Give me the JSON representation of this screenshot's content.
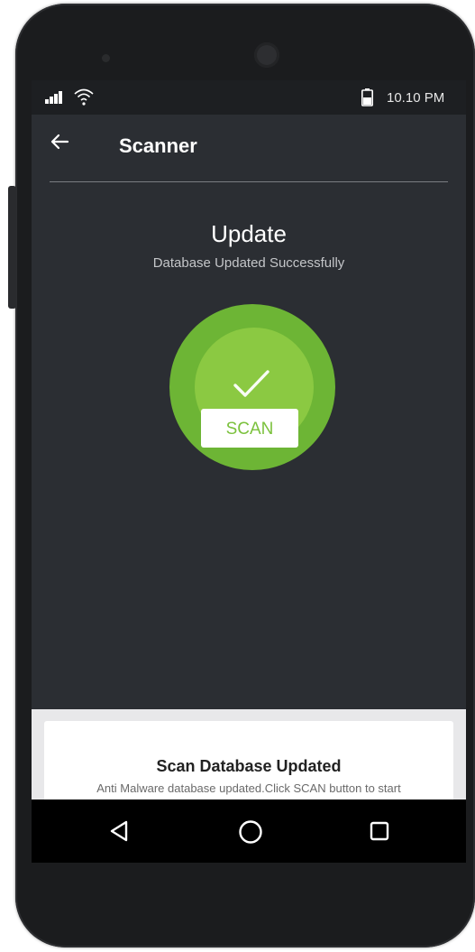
{
  "status_bar": {
    "time": "10.10 PM",
    "icons": [
      "signal-icon",
      "wifi-icon",
      "battery-icon"
    ]
  },
  "toolbar": {
    "back_icon": "back-arrow-icon",
    "title": "Scanner"
  },
  "update": {
    "heading": "Update",
    "subtitle": "Database Updated Successfully",
    "status_icon": "check-icon",
    "scan_label": "SCAN"
  },
  "card": {
    "title": "Scan Database Updated",
    "text": "Anti Malware database updated.Click SCAN button to start"
  },
  "nav": {
    "icons": [
      "nav-back-icon",
      "nav-home-icon",
      "nav-recents-icon"
    ]
  },
  "colors": {
    "screen_bg": "#2b2e33",
    "accent_green": "#6db535",
    "accent_green_light": "#8bc942",
    "scan_text": "#7bc13d"
  }
}
